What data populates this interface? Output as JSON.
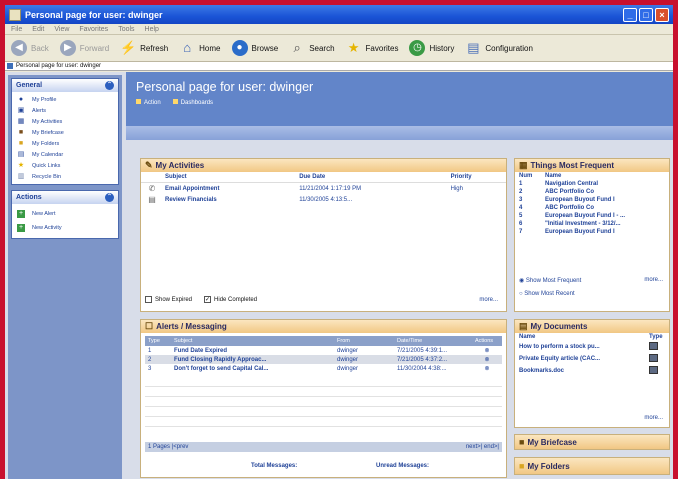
{
  "window": {
    "title": "Personal page for user: dwinger"
  },
  "menu": [
    "File",
    "Edit",
    "View",
    "Favorites",
    "Tools",
    "Help"
  ],
  "toolbar": {
    "back": "Back",
    "forward": "Forward",
    "refresh": "Refresh",
    "home": "Home",
    "browse": "Browse",
    "search": "Search",
    "favorites": "Favorites",
    "history": "History",
    "configuration": "Configuration"
  },
  "address": {
    "text": "Personal page for user: dwinger"
  },
  "sidebar": {
    "general_title": "General",
    "general_items": [
      {
        "label": "My Profile",
        "icon": "person-icon"
      },
      {
        "label": "Alerts",
        "icon": "alert-icon"
      },
      {
        "label": "My Activities",
        "icon": "activities-icon"
      },
      {
        "label": "My Briefcase",
        "icon": "briefcase-icon"
      },
      {
        "label": "My Folders",
        "icon": "folder-icon"
      },
      {
        "label": "My Calendar",
        "icon": "calendar-icon"
      },
      {
        "label": "Quick Links",
        "icon": "star-icon"
      },
      {
        "label": "Recycle Bin",
        "icon": "trash-icon"
      }
    ],
    "actions_title": "Actions",
    "actions_items": [
      {
        "label": "New Alert",
        "icon": "plus-icon"
      },
      {
        "label": "New Activity",
        "icon": "plus-icon"
      }
    ]
  },
  "header": {
    "title": "Personal page for user: dwinger",
    "links": [
      "Action",
      "Dashboards"
    ]
  },
  "activities": {
    "title": "My Activities",
    "columns": [
      "Subject",
      "Due Date",
      "Priority"
    ],
    "rows": [
      {
        "subject": "Email Appointment",
        "due": "11/21/2004 1:17:19 PM",
        "priority": "High"
      },
      {
        "subject": "Review Financials",
        "due": "11/30/2005 4:13:5..."
      }
    ],
    "show_expired": "Show Expired",
    "hide_completed": "Hide Completed",
    "more": "more..."
  },
  "alerts": {
    "title": "Alerts / Messaging",
    "columns": [
      "Type",
      "Subject",
      "From",
      "Date/Time",
      "Actions"
    ],
    "rows": [
      {
        "num": "1",
        "subject": "Fund Date Expired",
        "from": "dwinger",
        "date": "7/21/2005 4:39:1..."
      },
      {
        "num": "2",
        "subject": "Fund Closing Rapidly Approac...",
        "from": "dwinger",
        "date": "7/21/2005 4:37:2..."
      },
      {
        "num": "3",
        "subject": "Don't forget to send Capital Cal...",
        "from": "dwinger",
        "date": "11/30/2004 4:38:..."
      }
    ],
    "pager_left": "1 Pages  |<prev",
    "pager_right": "next>|  end>|",
    "total": "Total Messages:",
    "unread": "Unread Messages:"
  },
  "frequent": {
    "title": "Things Most Frequent",
    "columns": [
      "Num",
      "Name"
    ],
    "rows": [
      {
        "num": "1",
        "name": "Navigation Central"
      },
      {
        "num": "2",
        "name": "ABC Portfolio Co"
      },
      {
        "num": "3",
        "name": "European Buyout Fund I"
      },
      {
        "num": "4",
        "name": "ABC Portfolio Co"
      },
      {
        "num": "5",
        "name": "European Buyout Fund I - ..."
      },
      {
        "num": "6",
        "name": "\"Initial Investment - 3/12/..."
      },
      {
        "num": "7",
        "name": "European Buyout Fund I"
      }
    ],
    "opt1": "Show Most Frequent",
    "opt2": "Show Most Recent",
    "more": "more..."
  },
  "documents": {
    "title": "My Documents",
    "columns": [
      "Name",
      "Type"
    ],
    "rows": [
      "How to perform a stock pu...",
      "Private Equity article (CAC...",
      "Bookmarks.doc"
    ],
    "more": "more..."
  },
  "briefcase": {
    "title": "My Briefcase"
  },
  "folders": {
    "title": "My Folders"
  }
}
